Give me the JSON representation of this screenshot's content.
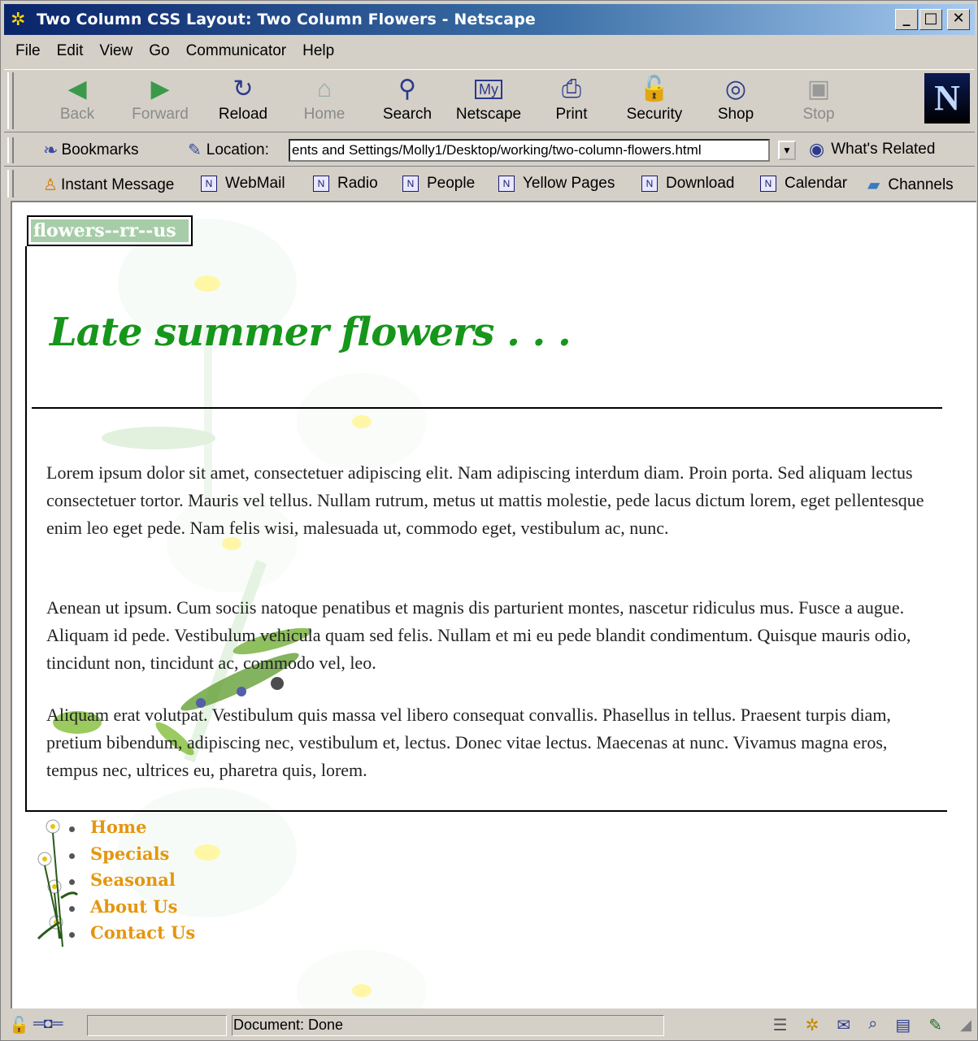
{
  "window": {
    "title": "Two Column CSS Layout: Two Column Flowers - Netscape"
  },
  "menu": [
    "File",
    "Edit",
    "View",
    "Go",
    "Communicator",
    "Help"
  ],
  "toolbar": [
    {
      "label": "Back",
      "icon": "back-arrow-icon",
      "disabled": true
    },
    {
      "label": "Forward",
      "icon": "forward-arrow-icon",
      "disabled": true
    },
    {
      "label": "Reload",
      "icon": "reload-icon",
      "disabled": false
    },
    {
      "label": "Home",
      "icon": "home-icon",
      "disabled": true
    },
    {
      "label": "Search",
      "icon": "search-icon",
      "disabled": false
    },
    {
      "label": "Netscape",
      "icon": "my-netscape-icon",
      "disabled": false
    },
    {
      "label": "Print",
      "icon": "print-icon",
      "disabled": false
    },
    {
      "label": "Security",
      "icon": "security-lock-icon",
      "disabled": false
    },
    {
      "label": "Shop",
      "icon": "shop-icon",
      "disabled": false
    },
    {
      "label": "Stop",
      "icon": "stop-icon",
      "disabled": true
    }
  ],
  "location": {
    "bookmarks_label": "Bookmarks",
    "location_label": "Location:",
    "url": "ents and Settings/Molly1/Desktop/working/two-column-flowers.html",
    "related_label": "What's Related"
  },
  "personal_toolbar": [
    "Instant Message",
    "WebMail",
    "Radio",
    "People",
    "Yellow Pages",
    "Download",
    "Calendar",
    "Channels"
  ],
  "page": {
    "logo_text": "flowers--rr--us",
    "heading": "Late summer flowers . . .",
    "paragraphs": [
      "Lorem ipsum dolor sit amet, consectetuer adipiscing elit. Nam adipiscing interdum diam. Proin porta. Sed aliquam lectus consectetuer tortor. Mauris vel tellus. Nullam rutrum, metus ut mattis molestie, pede lacus dictum lorem, eget pellentesque enim leo eget pede. Nam felis wisi, malesuada ut, commodo eget, vestibulum ac, nunc.",
      "Aenean ut ipsum. Cum sociis natoque penatibus et magnis dis parturient montes, nascetur ridiculus mus. Fusce a augue. Aliquam id pede. Vestibulum vehicula quam sed felis. Nullam et mi eu pede blandit condimentum. Quisque mauris odio, tincidunt non, tincidunt ac, commodo vel, leo.",
      "Aliquam erat volutpat. Vestibulum quis massa vel libero consequat convallis. Phasellus in tellus. Praesent turpis diam, pretium bibendum, adipiscing nec, vestibulum et, lectus. Donec vitae lectus. Maecenas at nunc. Vivamus magna eros, tempus nec, ultrices eu, pharetra quis, lorem."
    ],
    "nav": [
      "Home",
      "Specials",
      "Seasonal",
      "About Us",
      "Contact Us"
    ],
    "colors": {
      "heading": "#16961b",
      "nav": "#e5960e",
      "logo_bg": "#a6cda8"
    }
  },
  "status": {
    "text": "Document: Done"
  }
}
